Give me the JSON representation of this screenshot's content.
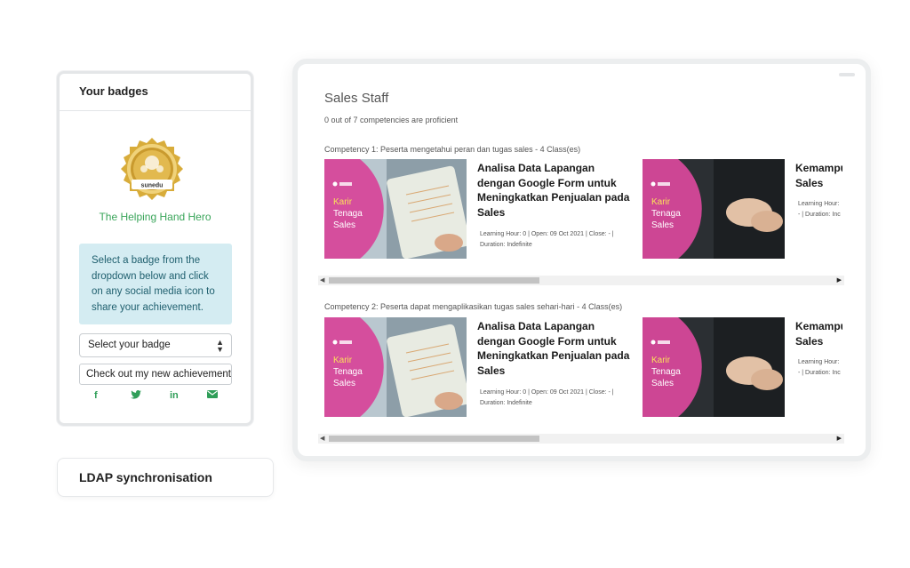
{
  "badges": {
    "title": "Your badges",
    "badge_logo_text": "sunedu",
    "badge_name": "The Helping Hand Hero",
    "info": "Select a badge from the dropdown below and click on any social media icon to share your achievement.",
    "select_value": "Select your badge",
    "share_text": "Check out my new achievement",
    "social_icons": [
      "facebook-icon",
      "twitter-icon",
      "linkedin-icon",
      "email-icon"
    ]
  },
  "ldap": {
    "label": "LDAP synchronisation"
  },
  "panel": {
    "title": "Sales Staff",
    "subtitle": "0 out of 7 competencies are proficient",
    "competencies": [
      {
        "label": "Competency 1: Peserta mengetahui peran dan tugas sales - 4 Class(es)",
        "courses": [
          {
            "thumb_line1": "Karir",
            "thumb_line2": "Tenaga",
            "thumb_line3": "Sales",
            "title": "Analisa Data Lapangan dengan Google Form untuk Meningkatkan Penjualan pada Sales",
            "meta": "Learning Hour: 0 | Open: 09 Oct 2021 | Close: - | Duration: Indefinite"
          },
          {
            "thumb_line1": "Karir",
            "thumb_line2": "Tenaga",
            "thumb_line3": "Sales",
            "title": "Kemampu Sales",
            "meta": "Learning Hour: - | Duration: Inc"
          }
        ]
      },
      {
        "label": "Competency 2: Peserta dapat mengaplikasikan tugas sales sehari-hari - 4 Class(es)",
        "courses": [
          {
            "thumb_line1": "Karir",
            "thumb_line2": "Tenaga",
            "thumb_line3": "Sales",
            "title": "Analisa Data Lapangan dengan Google Form untuk Meningkatkan Penjualan pada Sales",
            "meta": "Learning Hour: 0 | Open: 09 Oct 2021 | Close: - | Duration: Indefinite"
          },
          {
            "thumb_line1": "Karir",
            "thumb_line2": "Tenaga",
            "thumb_line3": "Sales",
            "title": "Kemampu Sales",
            "meta": "Learning Hour: - | Duration: Inc"
          }
        ]
      }
    ]
  },
  "colors": {
    "accent_green": "#3aa55a",
    "info_bg": "#d4ecf2",
    "thumb_pink": "#d6489a"
  }
}
